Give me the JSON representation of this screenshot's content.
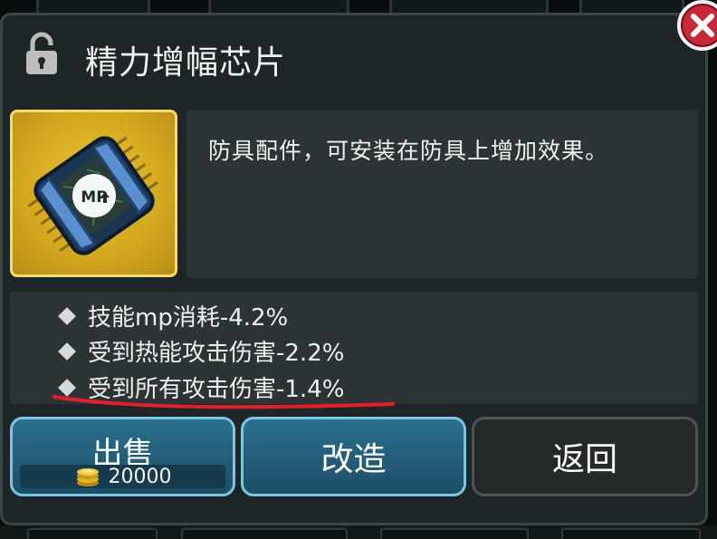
{
  "dialog": {
    "title": "精力增幅芯片",
    "description": "防具配件，可安装在防具上增加效果。",
    "item_icon": "mp-chip-icon",
    "lock_icon": "lock-open-icon",
    "close_icon": "close-icon"
  },
  "attributes": [
    {
      "text": "技能mp消耗-4.2%"
    },
    {
      "text": "受到热能攻击伤害-2.2%"
    },
    {
      "text": "受到所有攻击伤害-1.4%"
    }
  ],
  "buttons": {
    "sell_label": "出售",
    "sell_price": "20000",
    "modify_label": "改造",
    "back_label": "返回"
  },
  "colors": {
    "accent_blue": "#2c6f8e",
    "close_red": "#c7283a",
    "icon_gold": "#d5a91f",
    "annotation_red": "#e0202a"
  }
}
